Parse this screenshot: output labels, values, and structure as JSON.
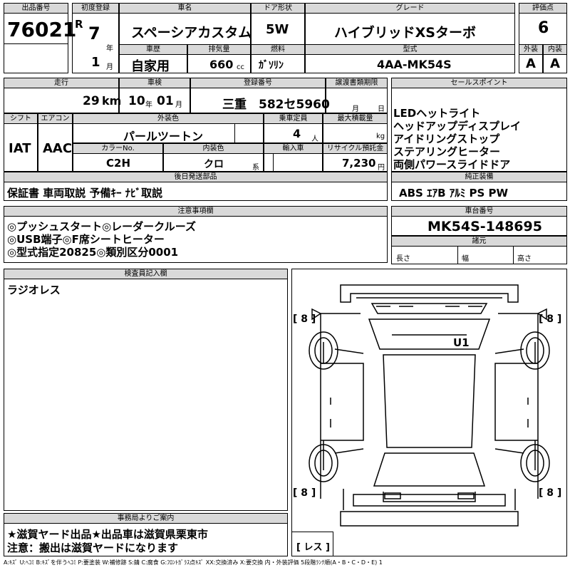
{
  "header": {
    "lot_number_label": "出品番号",
    "lot_number": "76021",
    "first_reg_label": "初度登録",
    "era": "R",
    "year": "7",
    "year_unit": "年",
    "month": "1",
    "month_unit": "月",
    "car_name_label": "車名",
    "car_name": "スペーシアカスタム",
    "door_label": "ドア形状",
    "door": "5W",
    "grade_label": "グレード",
    "grade": "ハイブリッドXSターボ",
    "score_label": "評価点",
    "score": "6",
    "history_label": "車歴",
    "history": "自家用",
    "displacement_label": "排気量",
    "displacement": "660",
    "displacement_unit": "cc",
    "fuel_label": "燃料",
    "fuel": "ｶﾞｿﾘﾝ",
    "model_label": "型式",
    "model": "4AA-MK54S",
    "exterior_label": "外装",
    "interior_label": "内装",
    "exterior_grade": "A",
    "interior_grade": "A"
  },
  "row2": {
    "mileage_label": "走行",
    "mileage": "29",
    "mileage_unit": "km",
    "inspection_label": "車検",
    "insp_year": "10",
    "insp_year_unit": "年",
    "insp_month": "01",
    "insp_month_unit": "月",
    "reg_label": "登録番号",
    "reg_number": "三重　582セ5960",
    "transfer_label": "譲渡書類期限",
    "transfer_month": "月",
    "transfer_day": "日",
    "shift_label": "シフト",
    "ac_label": "エアコン",
    "shift": "IAT",
    "ac": "AAC",
    "color_label": "外装色",
    "color": "パールツートン",
    "capacity_label": "乗車定員",
    "capacity": "4",
    "capacity_unit": "人",
    "load_label": "最大積載量",
    "load_unit": "kg",
    "color_no_label": "カラーNo.",
    "color_no": "C2H",
    "int_color_label": "内装色",
    "int_color": "クロ",
    "int_color_unit": "系",
    "import_label": "輸入車",
    "recycle_label": "リサイクル預託金",
    "recycle": "7,230",
    "recycle_unit": "円",
    "later_label": "後日発送部品",
    "later": "保証書 車両取説 予備ｷｰ ﾅﾋﾞ取説"
  },
  "sales": {
    "label": "セールスポイント",
    "points": [
      "LEDヘットライト",
      "ヘッドアップディスプレイ",
      "アイドリングストップ",
      "ステアリングヒーター",
      "両側パワースライドドア"
    ],
    "equip_label": "純正装備",
    "equip": "ABS ｴｱB ｱﾙﾐ PS PW"
  },
  "notes": {
    "label": "注意事項欄",
    "lines": [
      "◎プッシュスタート◎レーダークルーズ",
      "◎USB端子◎F席シートヒーター",
      "◎型式指定20825◎類別区分0001"
    ]
  },
  "chassis": {
    "label": "車台番号",
    "number": "MK54S-148695",
    "spec_label": "諸元",
    "length": "長さ",
    "width": "幅",
    "height": "高さ"
  },
  "inspector": {
    "label": "検査員記入欄",
    "text": "ラジオレス"
  },
  "diagram": {
    "tire_fl": "[ 8 ]",
    "tire_fr": "[ 8 ]",
    "tire_rl": "[ 8 ]",
    "tire_rr": "[ 8 ]",
    "spare": "[ レス ]",
    "mark": "U1"
  },
  "office": {
    "label": "事務局よりご案内",
    "line1": "★滋賀ヤード出品★出品車は滋賀県栗東市",
    "line2": "注意：搬出は滋賀ヤードになります"
  },
  "legend": "A:ｷｽﾞ U:ﾍｺﾐ B:ｷｽﾞを伴うﾍｺﾐ P:要塗装 W:補修跡 S:錆 C:腐食 G:ﾌﾛﾝﾄｶﾞﾗｽ点ｷｽﾞ XX:交換済み X:要交換 内・外装評価 5段階ﾗﾝｸ順(A・B・C・D・E) 1"
}
